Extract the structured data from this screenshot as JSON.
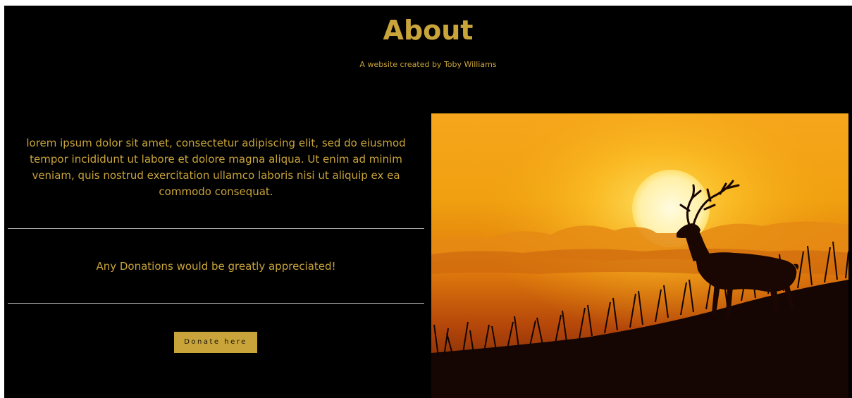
{
  "header": {
    "title": "About",
    "subtitle": "A website created by Toby Williams"
  },
  "content": {
    "intro": "lorem ipsum dolor sit amet, consectetur adipiscing elit, sed do eiusmod tempor incididunt ut labore et dolore magna aliqua. Ut enim ad minim veniam, quis nostrud exercitation ullamco laboris nisi ut aliquip ex ea commodo consequat.",
    "donation_message": "Any Donations would be greatly appreciated!",
    "donate_button_label": "Donate here"
  },
  "photo": {
    "subject": "deer silhouette at sunset"
  },
  "colors": {
    "background": "#000000",
    "accent": "#c9a43a",
    "divider": "#b8b8b8"
  }
}
